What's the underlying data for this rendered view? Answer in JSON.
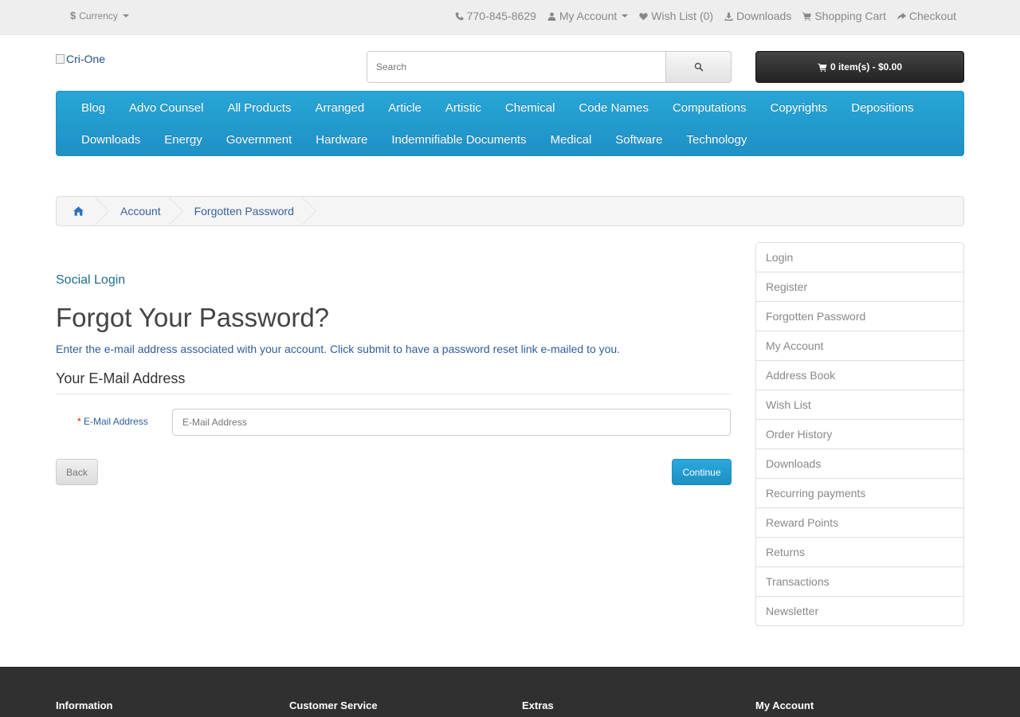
{
  "topbar": {
    "currency_symbol": "$",
    "currency_label": "Currency",
    "phone": "770-845-8629",
    "my_account": "My Account",
    "wishlist": "Wish List (0)",
    "downloads": "Downloads",
    "shopping_cart": "Shopping Cart",
    "checkout": "Checkout"
  },
  "header": {
    "logo_alt": "Cri-One",
    "search_placeholder": "Search",
    "cart_button": "0 item(s) - $0.00"
  },
  "menu": {
    "row1": [
      "Blog",
      "Advo Counsel",
      "All Products",
      "Arranged",
      "Article",
      "Artistic",
      "Chemical",
      "Code Names",
      "Computations",
      "Copyrights",
      "Depositions"
    ],
    "row2": [
      "Downloads",
      "Energy",
      "Government",
      "Hardware",
      "Indemnifiable Documents",
      "Medical",
      "Software",
      "Technology"
    ]
  },
  "breadcrumb": {
    "items": [
      "Account",
      "Forgotten Password"
    ]
  },
  "main": {
    "social_login": "Social Login",
    "title": "Forgot Your Password?",
    "description": "Enter the e-mail address associated with your account. Click submit to have a password reset link e-mailed to you.",
    "legend": "Your E-Mail Address",
    "email_required_mark": "*",
    "email_label": "E-Mail Address",
    "email_placeholder": "E-Mail Address",
    "email_value": "",
    "back_button": "Back",
    "continue_button": "Continue"
  },
  "sidebar": {
    "items": [
      "Login",
      "Register",
      "Forgotten Password",
      "My Account",
      "Address Book",
      "Wish List",
      "Order History",
      "Downloads",
      "Recurring payments",
      "Reward Points",
      "Returns",
      "Transactions",
      "Newsletter"
    ]
  },
  "footer": {
    "information": "Information",
    "customer_service": "Customer Service",
    "extras": "Extras",
    "my_account": "My Account"
  },
  "colors": {
    "menu_blue": "#229ac8",
    "cart_dark": "#303030",
    "continue_blue": "#1e91cf",
    "footer_bg": "#303030"
  }
}
